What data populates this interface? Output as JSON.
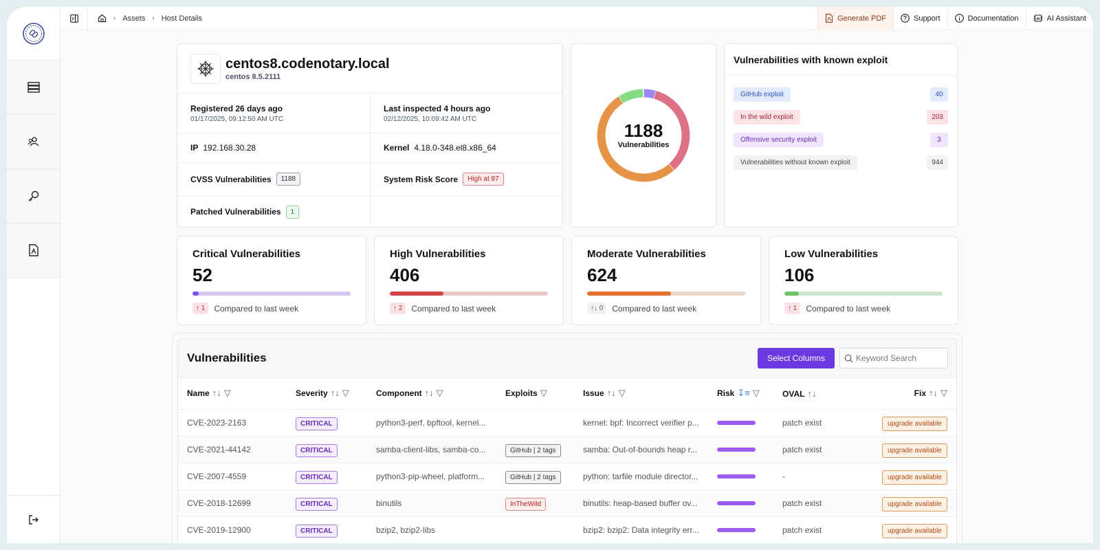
{
  "sidebar": {
    "items": [
      {
        "icon": "server-icon",
        "label": "Assets"
      },
      {
        "icon": "users-icon",
        "label": "Users"
      },
      {
        "icon": "key-icon",
        "label": "Keys"
      },
      {
        "icon": "pdf-report-icon",
        "label": "Reports"
      }
    ],
    "logout_icon": "logout-icon"
  },
  "topbar": {
    "breadcrumb": [
      "Assets",
      "Host Details"
    ],
    "actions": {
      "generate_pdf": "Generate PDF",
      "support": "Support",
      "documentation": "Documentation",
      "ai_assistant": "AI Assistant"
    }
  },
  "host": {
    "name": "centos8.codenotary.local",
    "os": "centos 8.5.2111",
    "registered_label": "Registered 26 days ago",
    "registered_date": "01/17/2025, 09:12:50 AM UTC",
    "inspected_label": "Last inspected 4 hours ago",
    "inspected_date": "02/12/2025, 10:09:42 AM UTC",
    "ip_label": "IP",
    "ip": "192.168.30.28",
    "kernel_label": "Kernel",
    "kernel": "4.18.0-348.el8.x86_64",
    "cvss_label": "CVSS Vulnerabilities",
    "cvss_count": "1188",
    "risk_label": "System Risk Score",
    "risk_value": "High at 97",
    "patched_label": "Patched Vulnerabilities",
    "patched_count": "1"
  },
  "donut": {
    "total": "1188",
    "label": "Vulnerabilities",
    "segments": [
      {
        "name": "Critical",
        "value": 52,
        "color": "#9b88f5"
      },
      {
        "name": "High",
        "value": 406,
        "color": "#de7185"
      },
      {
        "name": "Moderate",
        "value": 624,
        "color": "#e69345"
      },
      {
        "name": "Low",
        "value": 106,
        "color": "#85dc84"
      }
    ]
  },
  "exploits": {
    "title": "Vulnerabilities with known exploit",
    "items": [
      {
        "label": "GitHub exploit",
        "count": "40",
        "tone": "blue"
      },
      {
        "label": "In the wild exploit",
        "count": "203",
        "tone": "red"
      },
      {
        "label": "Offensive security exploit",
        "count": "3",
        "tone": "purple"
      },
      {
        "label": "Vulnerabilities without known exploit",
        "count": "944",
        "tone": "gray"
      }
    ]
  },
  "metrics": [
    {
      "title": "Critical Vulnerabilities",
      "value": "52",
      "fill_fraction": 0.04,
      "fill": "#7b4ff0",
      "track": "#d2c8f0",
      "delta": "1",
      "delta_dir": "up",
      "compare": "Compared to last week"
    },
    {
      "title": "High Vulnerabilities",
      "value": "406",
      "fill_fraction": 0.34,
      "fill": "#d44447",
      "track": "#ecc8c8",
      "delta": "2",
      "delta_dir": "up",
      "compare": "Compared to last week"
    },
    {
      "title": "Moderate Vulnerabilities",
      "value": "624",
      "fill_fraction": 0.53,
      "fill": "#e0702a",
      "track": "#ecd7c8",
      "delta": "0",
      "delta_dir": "flat",
      "compare": "Compared to last week"
    },
    {
      "title": "Low Vulnerabilities",
      "value": "106",
      "fill_fraction": 0.09,
      "fill": "#6fc46a",
      "track": "#cfe4cd",
      "delta": "1",
      "delta_dir": "up",
      "compare": "Compared to last week"
    }
  ],
  "table": {
    "title": "Vulnerabilities",
    "select_columns": "Select Columns",
    "search_placeholder": "Keyword Search",
    "columns": [
      "Name",
      "Severity",
      "Component",
      "Exploits",
      "Issue",
      "Risk",
      "OVAL",
      "Fix"
    ],
    "rows": [
      {
        "name": "CVE-2023-2163",
        "severity": "CRITICAL",
        "component": "python3-perf, bpftool, kernel...",
        "exploit": "",
        "exploit_type": "",
        "issue": "kernel: bpf: Incorrect verifier p...",
        "oval": "patch exist",
        "fix": "upgrade available"
      },
      {
        "name": "CVE-2021-44142",
        "severity": "CRITICAL",
        "component": "samba-client-libs, samba-co...",
        "exploit": "GitHub | 2 tags",
        "exploit_type": "gh",
        "issue": "samba: Out-of-bounds heap r...",
        "oval": "patch exist",
        "fix": "upgrade available"
      },
      {
        "name": "CVE-2007-4559",
        "severity": "CRITICAL",
        "component": "python3-pip-wheel, platform...",
        "exploit": "GitHub | 2 tags",
        "exploit_type": "gh",
        "issue": "python: tarfile module director...",
        "oval": "-",
        "fix": "upgrade available"
      },
      {
        "name": "CVE-2018-12699",
        "severity": "CRITICAL",
        "component": "binutils",
        "exploit": "InTheWild",
        "exploit_type": "wild",
        "issue": "binutils: heap-based buffer ov...",
        "oval": "patch exist",
        "fix": "upgrade available"
      },
      {
        "name": "CVE-2019-12900",
        "severity": "CRITICAL",
        "component": "bzip2, bzip2-libs",
        "exploit": "",
        "exploit_type": "",
        "issue": "bzip2: bzip2: Data integrity err...",
        "oval": "patch exist",
        "fix": "upgrade available"
      }
    ]
  }
}
